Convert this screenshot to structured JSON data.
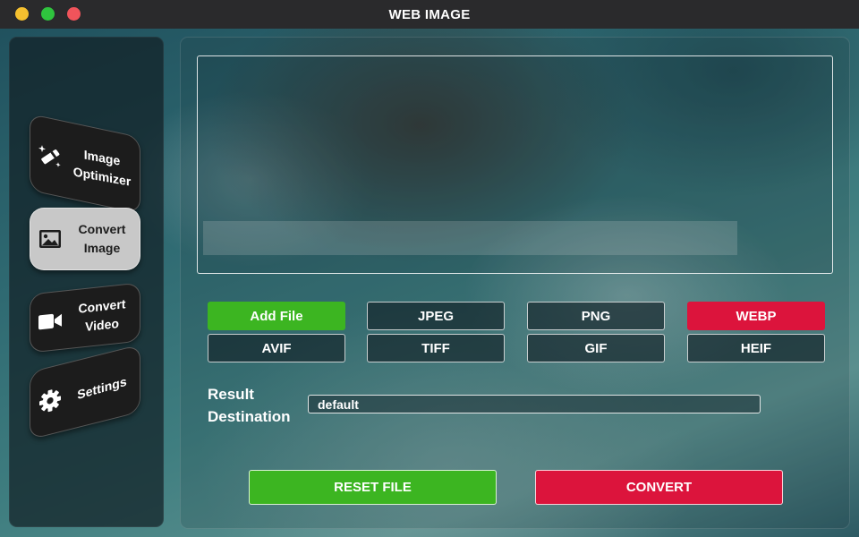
{
  "window": {
    "title": "WEB IMAGE"
  },
  "sidebar": {
    "items": [
      {
        "line1": "Image",
        "line2": "Optimizer",
        "icon": "magic-wand-icon"
      },
      {
        "line1": "Convert",
        "line2": "Image",
        "icon": "image-icon",
        "active": true
      },
      {
        "line1": "Convert",
        "line2": "Video",
        "icon": "video-camera-icon"
      },
      {
        "line1": "Settings",
        "icon": "gear-icon"
      }
    ]
  },
  "formats": {
    "row1": [
      "Add File",
      "JPEG",
      "PNG",
      "WEBP"
    ],
    "row2": [
      "AVIF",
      "TIFF",
      "GIF",
      "HEIF"
    ]
  },
  "destination": {
    "label_line1": "Result",
    "label_line2": "Destination",
    "value": "default"
  },
  "actions": {
    "reset_label": "RESET FILE",
    "convert_label": "CONVERT"
  },
  "colors": {
    "green": "#3cb521",
    "red": "#dc143c",
    "active_nav": "#c8c8c8"
  }
}
